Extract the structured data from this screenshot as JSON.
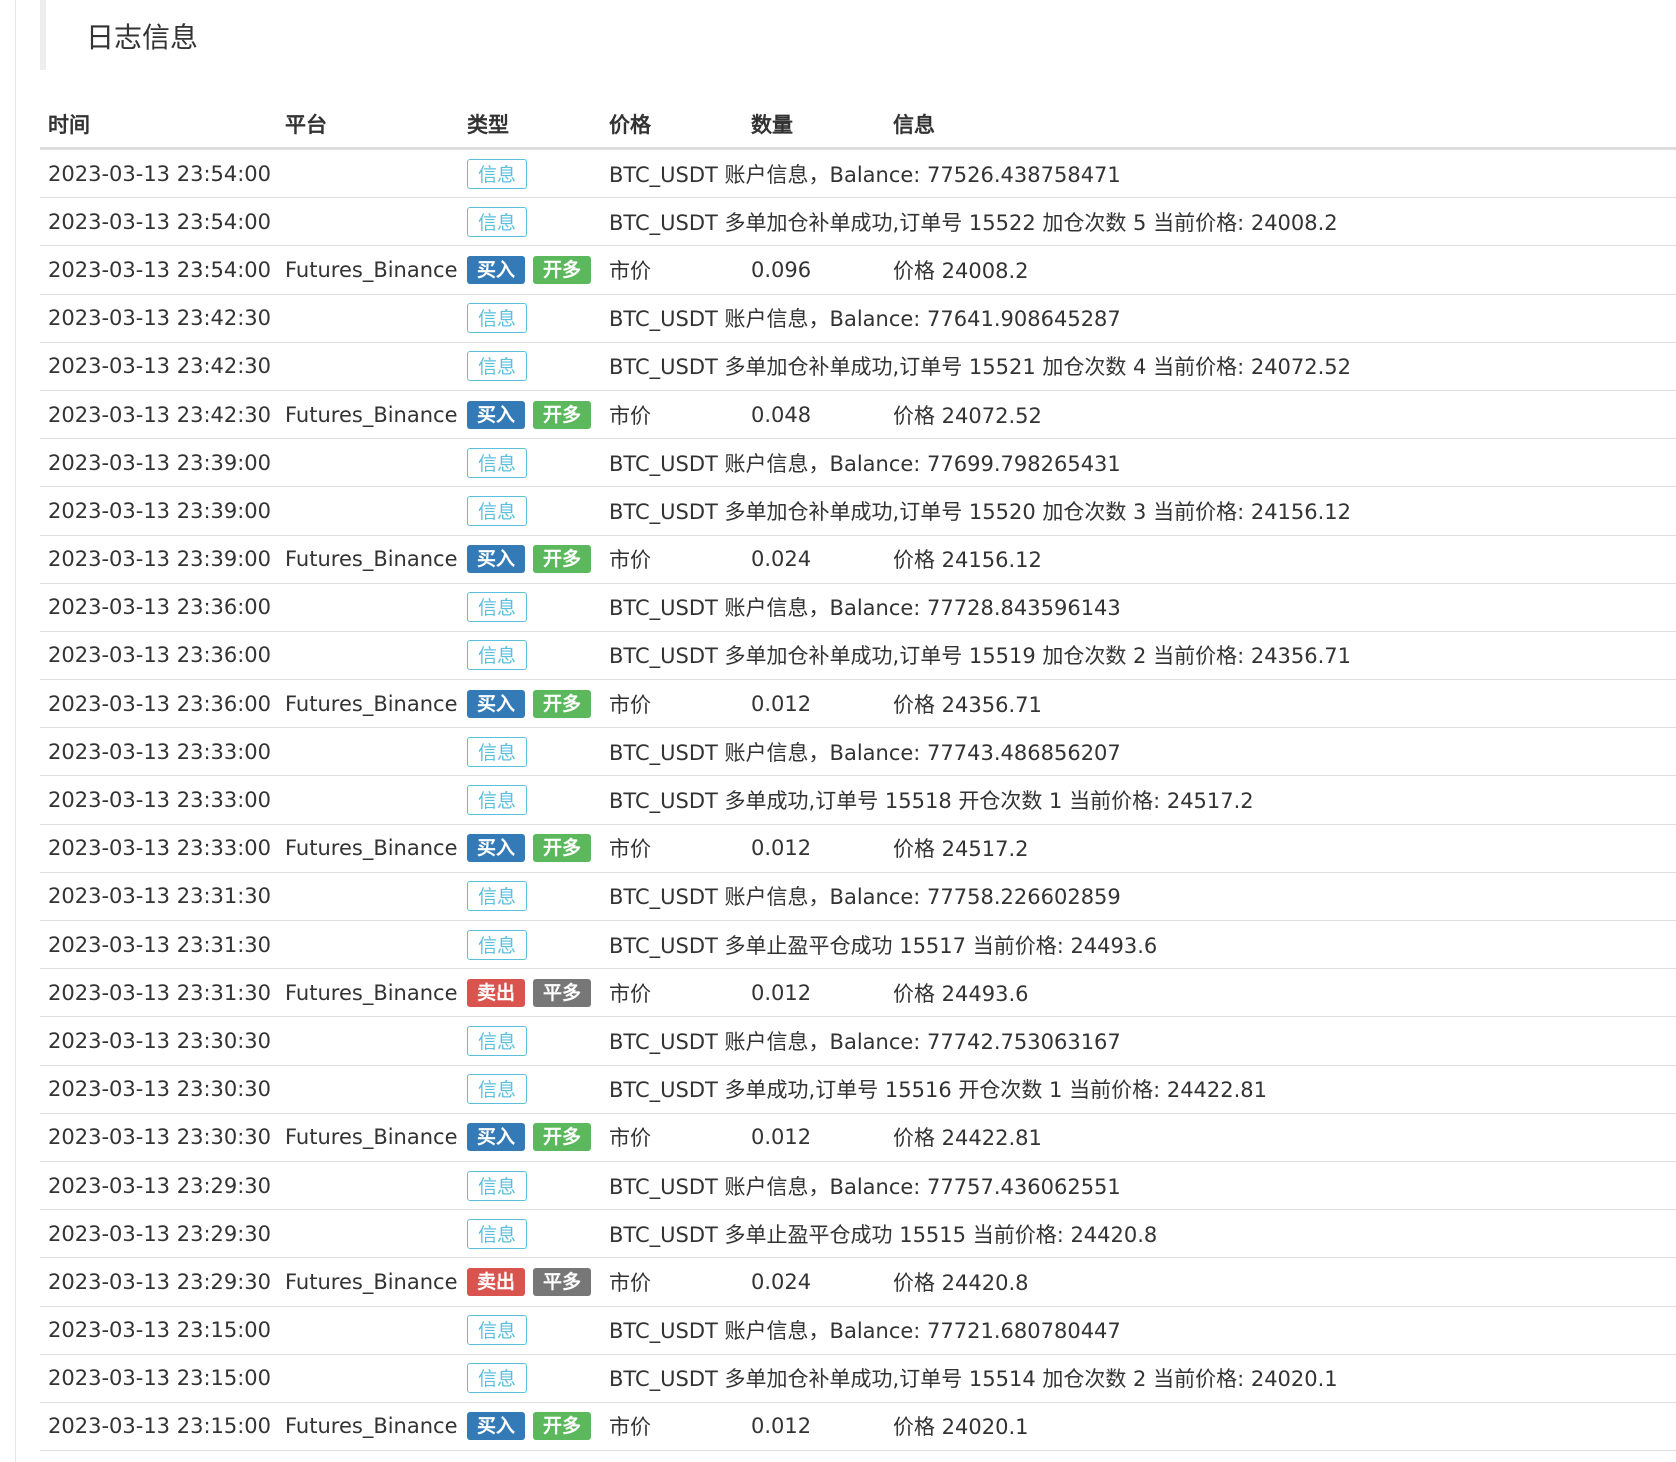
{
  "page": {
    "title": "日志信息"
  },
  "table": {
    "headers": {
      "time": "时间",
      "platform": "平台",
      "type": "类型",
      "price": "价格",
      "quantity": "数量",
      "info": "信息"
    },
    "rows": [
      {
        "kind": "info",
        "time": "2023-03-13 23:54:00",
        "label": "信息",
        "message": "BTC_USDT 账户信息，Balance: 77526.438758471"
      },
      {
        "kind": "info",
        "time": "2023-03-13 23:54:00",
        "label": "信息",
        "message": "BTC_USDT 多单加仓补单成功,订单号 15522 加仓次数 5 当前价格: 24008.2"
      },
      {
        "kind": "trade",
        "time": "2023-03-13 23:54:00",
        "platform": "Futures_Binance",
        "action": "买入",
        "direction": "开多",
        "side": "buy",
        "price": "市价",
        "quantity": "0.096",
        "info": "价格 24008.2"
      },
      {
        "kind": "info",
        "time": "2023-03-13 23:42:30",
        "label": "信息",
        "message": "BTC_USDT 账户信息，Balance: 77641.908645287"
      },
      {
        "kind": "info",
        "time": "2023-03-13 23:42:30",
        "label": "信息",
        "message": "BTC_USDT 多单加仓补单成功,订单号 15521 加仓次数 4 当前价格: 24072.52"
      },
      {
        "kind": "trade",
        "time": "2023-03-13 23:42:30",
        "platform": "Futures_Binance",
        "action": "买入",
        "direction": "开多",
        "side": "buy",
        "price": "市价",
        "quantity": "0.048",
        "info": "价格 24072.52"
      },
      {
        "kind": "info",
        "time": "2023-03-13 23:39:00",
        "label": "信息",
        "message": "BTC_USDT 账户信息，Balance: 77699.798265431"
      },
      {
        "kind": "info",
        "time": "2023-03-13 23:39:00",
        "label": "信息",
        "message": "BTC_USDT 多单加仓补单成功,订单号 15520 加仓次数 3 当前价格: 24156.12"
      },
      {
        "kind": "trade",
        "time": "2023-03-13 23:39:00",
        "platform": "Futures_Binance",
        "action": "买入",
        "direction": "开多",
        "side": "buy",
        "price": "市价",
        "quantity": "0.024",
        "info": "价格 24156.12"
      },
      {
        "kind": "info",
        "time": "2023-03-13 23:36:00",
        "label": "信息",
        "message": "BTC_USDT 账户信息，Balance: 77728.843596143"
      },
      {
        "kind": "info",
        "time": "2023-03-13 23:36:00",
        "label": "信息",
        "message": "BTC_USDT 多单加仓补单成功,订单号 15519 加仓次数 2 当前价格: 24356.71"
      },
      {
        "kind": "trade",
        "time": "2023-03-13 23:36:00",
        "platform": "Futures_Binance",
        "action": "买入",
        "direction": "开多",
        "side": "buy",
        "price": "市价",
        "quantity": "0.012",
        "info": "价格 24356.71"
      },
      {
        "kind": "info",
        "time": "2023-03-13 23:33:00",
        "label": "信息",
        "message": "BTC_USDT 账户信息，Balance: 77743.486856207"
      },
      {
        "kind": "info",
        "time": "2023-03-13 23:33:00",
        "label": "信息",
        "message": "BTC_USDT 多单成功,订单号 15518 开仓次数 1 当前价格: 24517.2"
      },
      {
        "kind": "trade",
        "time": "2023-03-13 23:33:00",
        "platform": "Futures_Binance",
        "action": "买入",
        "direction": "开多",
        "side": "buy",
        "price": "市价",
        "quantity": "0.012",
        "info": "价格 24517.2"
      },
      {
        "kind": "info",
        "time": "2023-03-13 23:31:30",
        "label": "信息",
        "message": "BTC_USDT 账户信息，Balance: 77758.226602859"
      },
      {
        "kind": "info",
        "time": "2023-03-13 23:31:30",
        "label": "信息",
        "message": "BTC_USDT 多单止盈平仓成功 15517 当前价格: 24493.6"
      },
      {
        "kind": "trade",
        "time": "2023-03-13 23:31:30",
        "platform": "Futures_Binance",
        "action": "卖出",
        "direction": "平多",
        "side": "sell",
        "price": "市价",
        "quantity": "0.012",
        "info": "价格 24493.6"
      },
      {
        "kind": "info",
        "time": "2023-03-13 23:30:30",
        "label": "信息",
        "message": "BTC_USDT 账户信息，Balance: 77742.753063167"
      },
      {
        "kind": "info",
        "time": "2023-03-13 23:30:30",
        "label": "信息",
        "message": "BTC_USDT 多单成功,订单号 15516 开仓次数 1 当前价格: 24422.81"
      },
      {
        "kind": "trade",
        "time": "2023-03-13 23:30:30",
        "platform": "Futures_Binance",
        "action": "买入",
        "direction": "开多",
        "side": "buy",
        "price": "市价",
        "quantity": "0.012",
        "info": "价格 24422.81"
      },
      {
        "kind": "info",
        "time": "2023-03-13 23:29:30",
        "label": "信息",
        "message": "BTC_USDT 账户信息，Balance: 77757.436062551"
      },
      {
        "kind": "info",
        "time": "2023-03-13 23:29:30",
        "label": "信息",
        "message": "BTC_USDT 多单止盈平仓成功 15515 当前价格: 24420.8"
      },
      {
        "kind": "trade",
        "time": "2023-03-13 23:29:30",
        "platform": "Futures_Binance",
        "action": "卖出",
        "direction": "平多",
        "side": "sell",
        "price": "市价",
        "quantity": "0.024",
        "info": "价格 24420.8"
      },
      {
        "kind": "info",
        "time": "2023-03-13 23:15:00",
        "label": "信息",
        "message": "BTC_USDT 账户信息，Balance: 77721.680780447"
      },
      {
        "kind": "info",
        "time": "2023-03-13 23:15:00",
        "label": "信息",
        "message": "BTC_USDT 多单加仓补单成功,订单号 15514 加仓次数 2 当前价格: 24020.1"
      },
      {
        "kind": "trade",
        "time": "2023-03-13 23:15:00",
        "platform": "Futures_Binance",
        "action": "买入",
        "direction": "开多",
        "side": "buy",
        "price": "市价",
        "quantity": "0.012",
        "info": "价格 24020.1"
      }
    ]
  },
  "colors": {
    "buy": "#337ab7",
    "sell": "#d9534f",
    "open_long": "#5cb85c",
    "close_long": "#777777",
    "info_badge": "#5bc0de"
  }
}
